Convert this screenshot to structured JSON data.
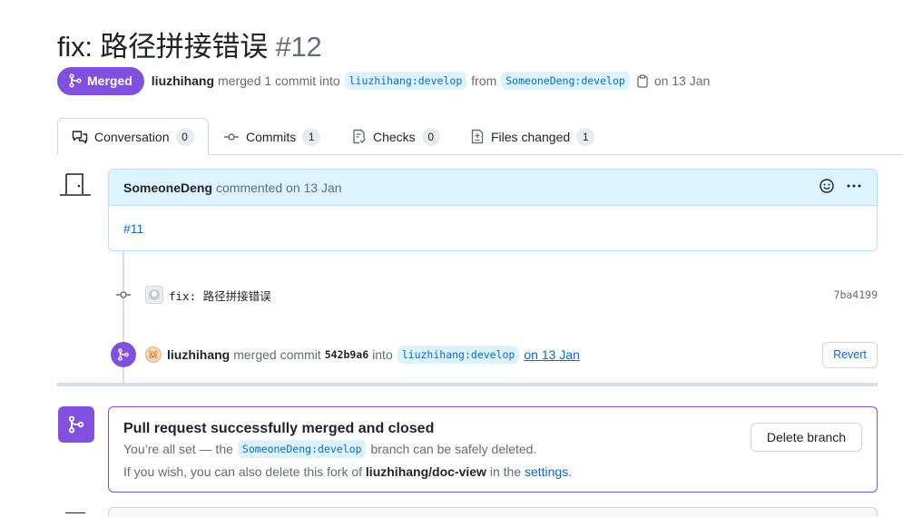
{
  "pr": {
    "title": "fix: 路径拼接错误",
    "number": "#12",
    "state_label": "Merged",
    "author": "liuzhihang",
    "merged_text": "merged 1 commit into",
    "base_branch": "liuzhihang:develop",
    "from_text": "from",
    "head_branch": "SomeoneDeng:develop",
    "date_text": "on 13 Jan"
  },
  "tabs": [
    {
      "label": "Conversation",
      "count": "0"
    },
    {
      "label": "Commits",
      "count": "1"
    },
    {
      "label": "Checks",
      "count": "0"
    },
    {
      "label": "Files changed",
      "count": "1"
    }
  ],
  "comment": {
    "author": "SomeoneDeng",
    "action": "commented on 13 Jan",
    "body_link": "#11"
  },
  "commit": {
    "message": "fix: 路径拼接错误",
    "sha": "7ba4199"
  },
  "merge_event": {
    "author": "liuzhihang",
    "text1": "merged commit",
    "sha": "542b9a6",
    "text2": "into",
    "branch": "liuzhihang:develop",
    "date": "on 13 Jan",
    "revert_label": "Revert"
  },
  "merge_box": {
    "heading": "Pull request successfully merged and closed",
    "line1_prefix": "You’re all set — the",
    "branch": "SomeoneDeng:develop",
    "line1_suffix": "branch can be safely deleted.",
    "line2_prefix": "If you wish, you can also delete this fork of",
    "repo": "liuzhihang/doc-view",
    "line2_mid": "in the",
    "settings_link": "settings",
    "line2_end": ".",
    "delete_label": "Delete branch"
  },
  "colors": {
    "merged_purple": "#8250df",
    "link_blue": "#0969da",
    "comment_header": "#ddf4ff"
  }
}
